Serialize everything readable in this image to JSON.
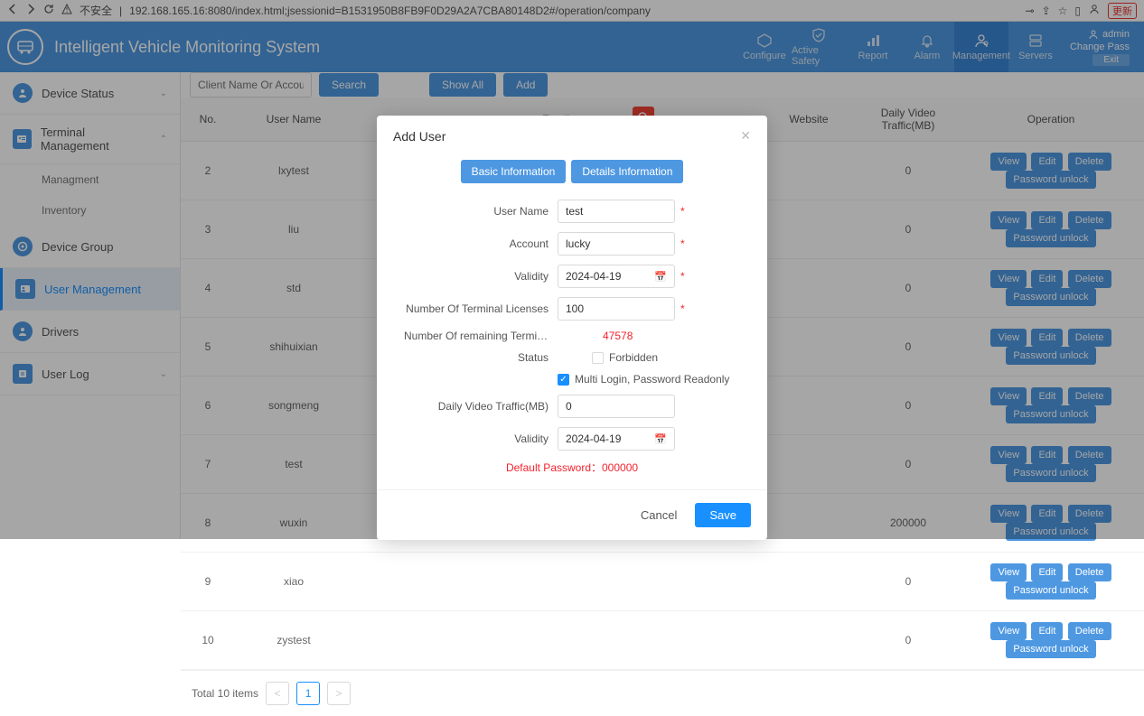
{
  "browser": {
    "insecure": "不安全",
    "url": "192.168.165.16:8080/index.html;jsessionid=B1531950B8FB9F0D29A2A7CBA80148D2#/operation/company",
    "refresh": "更新"
  },
  "header": {
    "title": "Intelligent Vehicle Monitoring System",
    "nav": [
      "Configure",
      "Active Safety",
      "Report",
      "Alarm",
      "Management",
      "Servers"
    ],
    "user": "admin",
    "change_pass": "Change Pass",
    "exit": "Exit"
  },
  "sidebar": {
    "device_status": "Device Status",
    "terminal_mgmt": "Terminal Management",
    "managment": "Managment",
    "inventory": "Inventory",
    "device_group": "Device Group",
    "user_mgmt": "User Management",
    "drivers": "Drivers",
    "user_log": "User Log"
  },
  "toolbar": {
    "search_ph": "Client Name Or Account",
    "search": "Search",
    "show_all": "Show All",
    "add": "Add"
  },
  "columns": [
    "No.",
    "User Name",
    "Email",
    "Website",
    "Daily Video Traffic(MB)",
    "Operation"
  ],
  "ops": {
    "view": "View",
    "edit": "Edit",
    "delete": "Delete",
    "unlock": "Password unlock"
  },
  "rows": [
    {
      "no": "2",
      "name": "lxytest",
      "traffic": "0"
    },
    {
      "no": "3",
      "name": "liu",
      "traffic": "0"
    },
    {
      "no": "4",
      "name": "std",
      "traffic": "0"
    },
    {
      "no": "5",
      "name": "shihuixian",
      "traffic": "0"
    },
    {
      "no": "6",
      "name": "songmeng",
      "traffic": "0"
    },
    {
      "no": "7",
      "name": "test",
      "traffic": "0"
    },
    {
      "no": "8",
      "name": "wuxin",
      "traffic": "200000"
    },
    {
      "no": "9",
      "name": "xiao",
      "traffic": "0"
    },
    {
      "no": "10",
      "name": "zystest",
      "traffic": "0"
    }
  ],
  "pager": {
    "total": "Total 10 items",
    "page": "1"
  },
  "modal": {
    "title": "Add User",
    "tab1": "Basic Information",
    "tab2": "Details Information",
    "labels": {
      "user_name": "User Name",
      "account": "Account",
      "validity": "Validity",
      "licenses": "Number Of Terminal Licenses",
      "remaining": "Number Of remaining Terminal Licen…",
      "status": "Status",
      "traffic": "Daily Video Traffic(MB)"
    },
    "values": {
      "user_name": "test",
      "account": "lucky",
      "validity": "2024-04-19",
      "licenses": "100",
      "remaining": "47578",
      "traffic": "0",
      "validity2": "2024-04-19"
    },
    "forbidden": "Forbidden",
    "multi": "Multi Login, Password Readonly",
    "default_pw": "Default Password：000000",
    "cancel": "Cancel",
    "save": "Save"
  }
}
